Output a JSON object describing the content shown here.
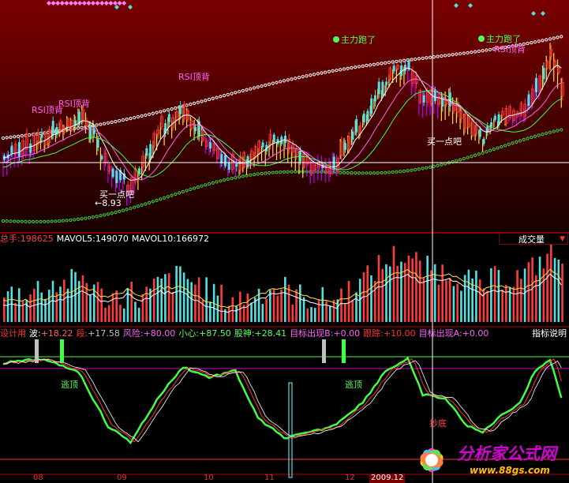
{
  "colors": {
    "background": "#000000",
    "price_panel_bg_top": "#7a0000",
    "price_panel_bg_bottom": "#1a0000",
    "divider": "#b40000",
    "up_candle": "#ff3b3b",
    "down_candle": "#52e0e0",
    "band_yellow": "#ffe040",
    "band_purple": "#b400ff",
    "green_dots": "#39d839",
    "white_dots": "#ffffff",
    "crosshair": "#ffffff",
    "logo_text": "#d400d4",
    "logo_url": "#ffc000"
  },
  "annotations": {
    "main_escape_1": "主力跑了",
    "main_escape_2": "主力跑了",
    "rsi_top_div_1": "RSI顶背",
    "rsi_top_div_2": "RSI顶背",
    "rsi_top_div_3": "RSI顶背",
    "rsi_top_div_4": "RSI顶背",
    "buy_point_1": "买一点吧",
    "buy_point_2": "买一点吧",
    "low_price": "←8.93",
    "escape_top_1": "逃顶",
    "escape_top_2": "逃顶",
    "bottom_copy": "抄底"
  },
  "volume_panel": {
    "total_label": "总手:",
    "total_value": "198625",
    "mavol5_label": "MAVOL5:",
    "mavol5_value": "149070",
    "mavol10_label": "MAVOL10:",
    "mavol10_value": "166972",
    "indicator_select": "成交量"
  },
  "indicator_panel": {
    "prefix": "设计用",
    "wave_label": "波:",
    "wave_value": "+18.22",
    "segment_label": "段:",
    "segment_value": "+17.58",
    "risk_label": "风险:",
    "risk_value": "+80.00",
    "careful_label": "小心:",
    "careful_value": "+87.50",
    "stock_god_label": "股神:",
    "stock_god_value": "+28.41",
    "target_b_label": "目标出现B:",
    "target_b_value": "+0.00",
    "follow_label": "跟踪:",
    "follow_value": "+10.00",
    "target_a_label": "目标出现A:",
    "target_a_value": "+0.00",
    "explain_button": "指标说明"
  },
  "dates": {
    "d1": "08",
    "d2": "09",
    "d3": "10",
    "d4": "11",
    "d5": "12",
    "d6": "2009.12"
  },
  "logo": {
    "text": "分析家公式网",
    "url": "www.88gs.com"
  }
}
